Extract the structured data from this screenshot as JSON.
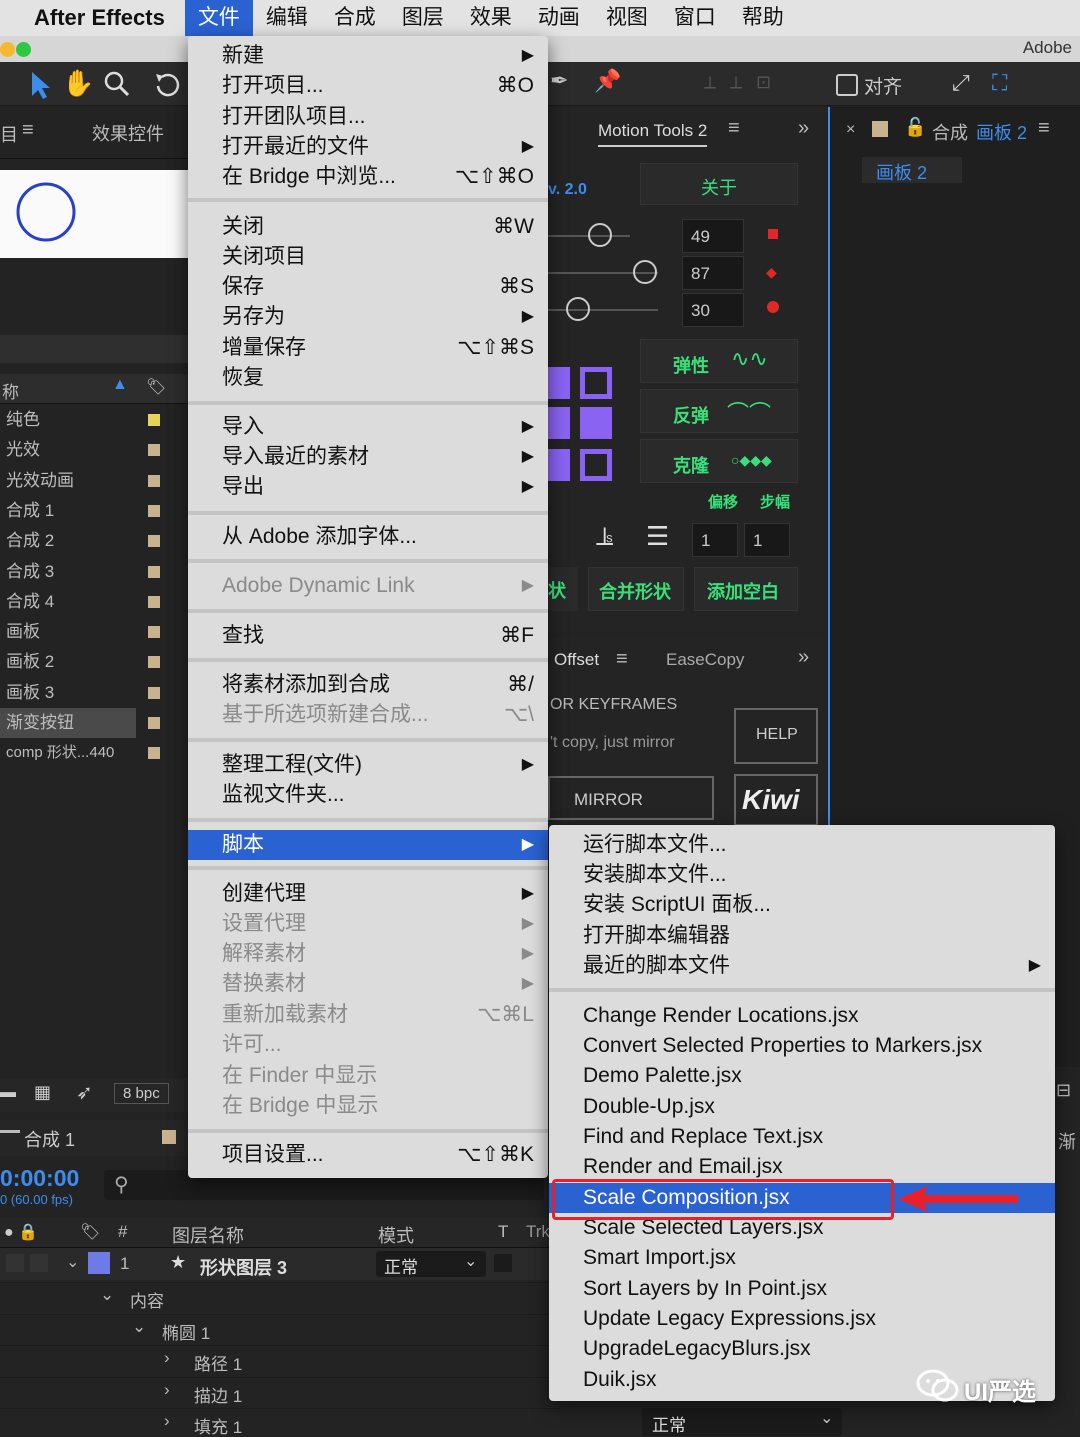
{
  "app_name": "After Effects",
  "menubar": [
    "文件",
    "编辑",
    "合成",
    "图层",
    "效果",
    "动画",
    "视图",
    "窗口",
    "帮助"
  ],
  "window_brand": "Adobe",
  "toolbar": {
    "align_label": "对齐"
  },
  "left_panel": {
    "tab": "效果控件",
    "col_name": "称"
  },
  "project_items": [
    "纯色",
    "光效",
    "光效动画",
    "合成 1",
    "合成 2",
    "合成 3",
    "合成 4",
    "画板",
    "画板 2",
    "画板 3",
    "渐变按钮",
    "comp 形状...440"
  ],
  "bottom_left": {
    "bpc": "8 bpc",
    "comp_tab": "合成 1",
    "timecode": "0:00:00",
    "fps": "0 (60.00 fps)"
  },
  "motion_tools": {
    "tab": "Motion Tools 2",
    "version": "v. 2.0",
    "about": "关于",
    "values": [
      "49",
      "87",
      "30"
    ],
    "btn_elastic": "弹性",
    "btn_bounce": "反弹",
    "btn_clone": "克隆",
    "lbl_offset": "偏移",
    "lbl_step": "步幅",
    "step_values": [
      "1",
      "1"
    ],
    "btn_shape": "状",
    "btn_merge": "合并形状",
    "btn_null": "添加空白"
  },
  "offset_panel": {
    "tab1": "Offset",
    "tab2": "EaseCopy",
    "line1": "OR KEYFRAMES",
    "line2": "'t copy, just mirror",
    "help": "HELP",
    "mirror": "MIRROR",
    "logo": "Kiwi"
  },
  "comp_panel": {
    "title": "合成",
    "name": "画板 2",
    "tab": "画板 2"
  },
  "timeline": {
    "col_num": "#",
    "col_name": "图层名称",
    "col_mode": "模式",
    "col_t": "T",
    "col_trk": "Trk",
    "layer_num": "1",
    "layer_name": "形状图层 3",
    "layer_mode": "正常",
    "tree": [
      "内容",
      "椭圆 1",
      "路径 1",
      "描边 1",
      "填充 1"
    ],
    "bottom_mode": "正常",
    "right_partial": "渐"
  },
  "file_menu": [
    {
      "label": "新建",
      "shortcut": "▶"
    },
    {
      "label": "打开项目...",
      "shortcut": "⌘O"
    },
    {
      "label": "打开团队项目...",
      "shortcut": ""
    },
    {
      "label": "打开最近的文件",
      "shortcut": "▶"
    },
    {
      "label": "在 Bridge 中浏览...",
      "shortcut": "⌥⇧⌘O"
    },
    {
      "label": "关闭",
      "shortcut": "⌘W"
    },
    {
      "label": "关闭项目",
      "shortcut": ""
    },
    {
      "label": "保存",
      "shortcut": "⌘S"
    },
    {
      "label": "另存为",
      "shortcut": "▶"
    },
    {
      "label": "增量保存",
      "shortcut": "⌥⇧⌘S"
    },
    {
      "label": "恢复",
      "shortcut": ""
    },
    {
      "label": "导入",
      "shortcut": "▶"
    },
    {
      "label": "导入最近的素材",
      "shortcut": "▶"
    },
    {
      "label": "导出",
      "shortcut": "▶"
    },
    {
      "label": "从 Adobe 添加字体...",
      "shortcut": ""
    },
    {
      "label": "Adobe Dynamic Link",
      "shortcut": "▶"
    },
    {
      "label": "查找",
      "shortcut": "⌘F"
    },
    {
      "label": "将素材添加到合成",
      "shortcut": "⌘/"
    },
    {
      "label": "基于所选项新建合成...",
      "shortcut": "⌥\\"
    },
    {
      "label": "整理工程(文件)",
      "shortcut": "▶"
    },
    {
      "label": "监视文件夹...",
      "shortcut": ""
    },
    {
      "label": "脚本",
      "shortcut": "▶"
    },
    {
      "label": "创建代理",
      "shortcut": "▶"
    },
    {
      "label": "设置代理",
      "shortcut": "▶"
    },
    {
      "label": "解释素材",
      "shortcut": "▶"
    },
    {
      "label": "替换素材",
      "shortcut": "▶"
    },
    {
      "label": "重新加载素材",
      "shortcut": "⌥⌘L"
    },
    {
      "label": "许可...",
      "shortcut": ""
    },
    {
      "label": "在 Finder 中显示",
      "shortcut": ""
    },
    {
      "label": "在 Bridge 中显示",
      "shortcut": ""
    },
    {
      "label": "项目设置...",
      "shortcut": "⌥⇧⌘K"
    }
  ],
  "script_menu": [
    {
      "label": "运行脚本文件...",
      "shortcut": ""
    },
    {
      "label": "安装脚本文件...",
      "shortcut": ""
    },
    {
      "label": "安装 ScriptUI 面板...",
      "shortcut": ""
    },
    {
      "label": "打开脚本编辑器",
      "shortcut": ""
    },
    {
      "label": "最近的脚本文件",
      "shortcut": "▶"
    },
    {
      "label": "Change Render Locations.jsx",
      "shortcut": ""
    },
    {
      "label": "Convert Selected Properties to Markers.jsx",
      "shortcut": ""
    },
    {
      "label": "Demo Palette.jsx",
      "shortcut": ""
    },
    {
      "label": "Double-Up.jsx",
      "shortcut": ""
    },
    {
      "label": "Find and Replace Text.jsx",
      "shortcut": ""
    },
    {
      "label": "Render and Email.jsx",
      "shortcut": ""
    },
    {
      "label": "Scale Composition.jsx",
      "shortcut": ""
    },
    {
      "label": "Scale Selected Layers.jsx",
      "shortcut": ""
    },
    {
      "label": "Smart Import.jsx",
      "shortcut": ""
    },
    {
      "label": "Sort Layers by In Point.jsx",
      "shortcut": ""
    },
    {
      "label": "Update Legacy Expressions.jsx",
      "shortcut": ""
    },
    {
      "label": "UpgradeLegacyBlurs.jsx",
      "shortcut": ""
    },
    {
      "label": "Duik.jsx",
      "shortcut": ""
    }
  ],
  "watermark": "UI严选",
  "colors": {
    "menu_highlight": "#2a62d2",
    "annotation_red": "#e8202a",
    "accent_green": "#38e07a",
    "comp_blue": "#2a3fc8"
  }
}
